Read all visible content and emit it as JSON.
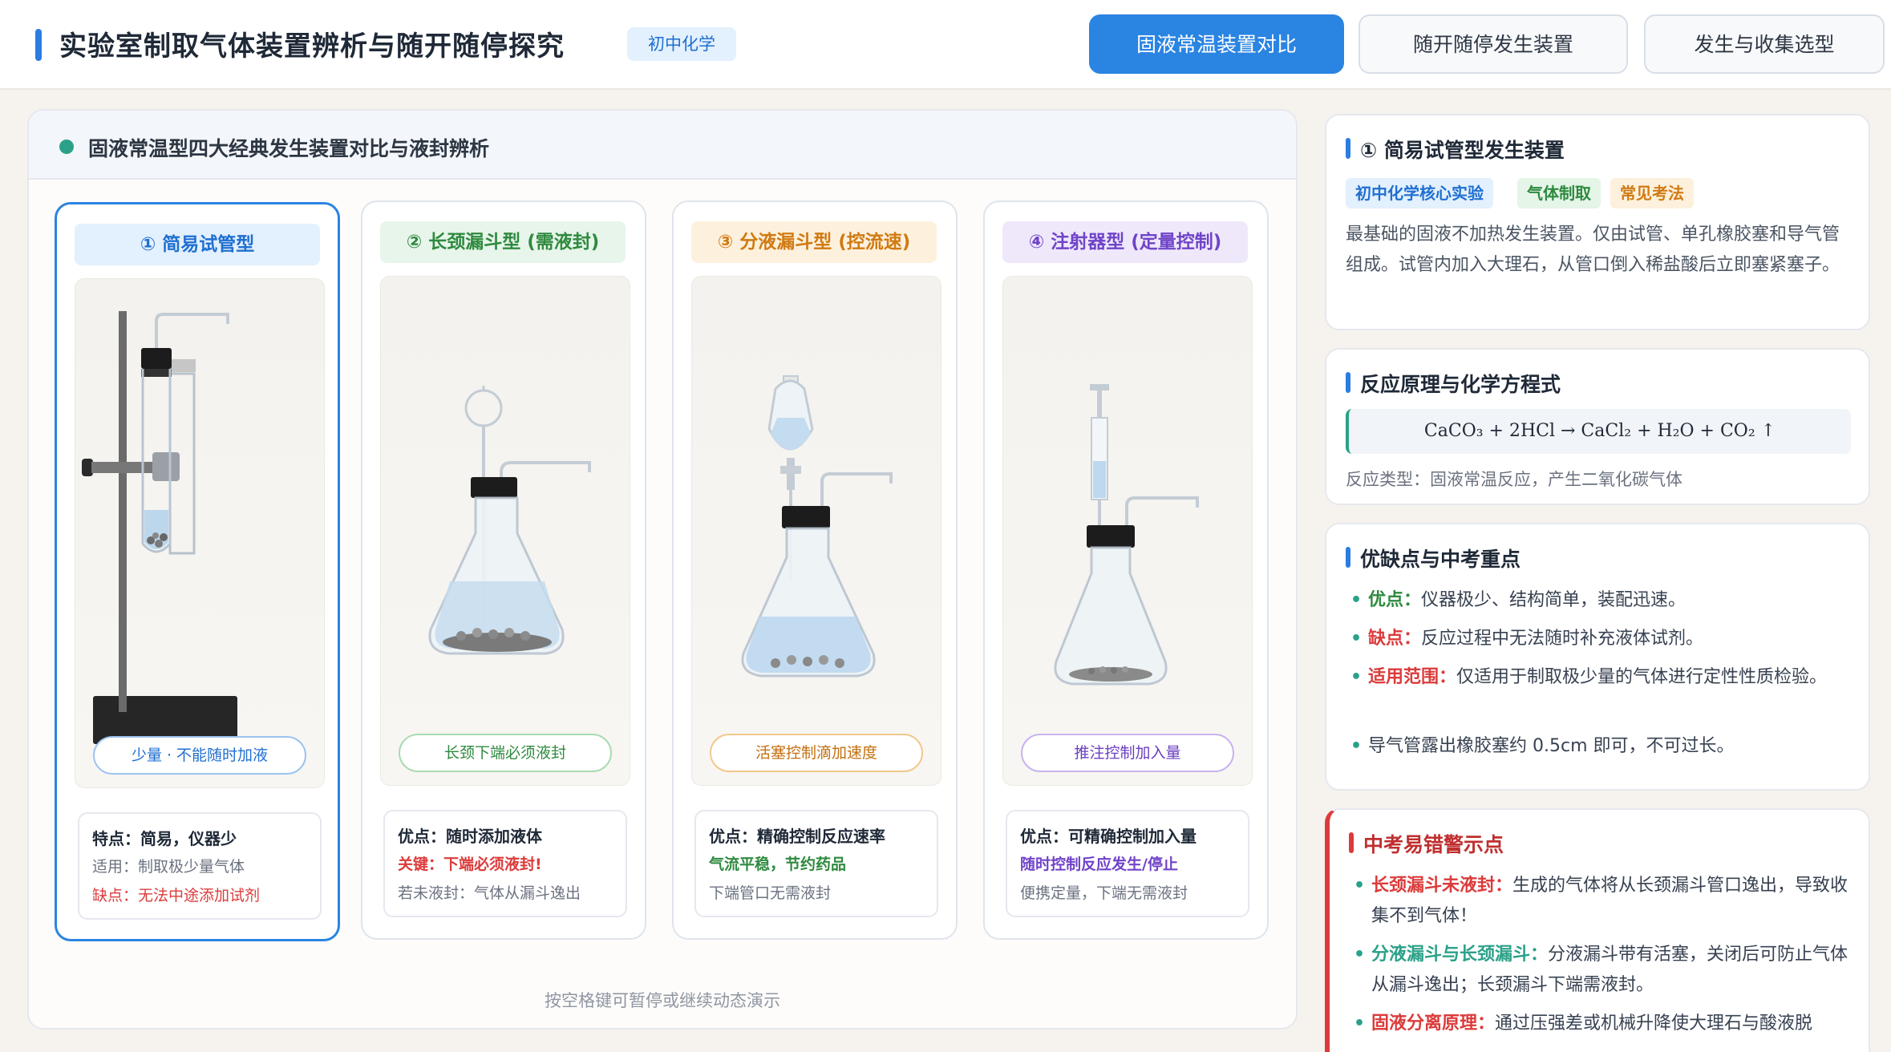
{
  "header": {
    "title": "实验室制取气体装置辨析与随开随停探究",
    "badge": "初中化学",
    "tabs": [
      {
        "label": "固液常温装置对比",
        "active": true
      },
      {
        "label": "随开随停发生装置",
        "active": false
      },
      {
        "label": "发生与收集选型",
        "active": false
      }
    ]
  },
  "left": {
    "title": "固液常温型四大经典发生装置对比与液封辨析",
    "hint": "按空格键可暂停或继续动态演示",
    "cards": [
      {
        "title": "① 简易试管型",
        "pill": "少量 · 不能随时加液",
        "line1": "特点：简易，仪器少",
        "line2": "适用：制取极少量气体",
        "line3": "缺点：无法中途添加试剂"
      },
      {
        "title": "② 长颈漏斗型 (需液封)",
        "pill": "长颈下端必须液封",
        "line1": "优点：随时添加液体",
        "line2": "关键：下端必须液封!",
        "line3": "若未液封：气体从漏斗逸出"
      },
      {
        "title": "③ 分液漏斗型 (控流速)",
        "pill": "活塞控制滴加速度",
        "line1": "优点：精确控制反应速率",
        "line2": "气流平稳，节约药品",
        "line3": "下端管口无需液封"
      },
      {
        "title": "④ 注射器型 (定量控制)",
        "pill": "推注控制加入量",
        "line1": "优点：可精确控制加入量",
        "line2": "随时控制反应发生/停止",
        "line3": "便携定量，下端无需液封"
      }
    ]
  },
  "right": {
    "device": {
      "title": "① 简易试管型发生装置",
      "tags": [
        "初中化学核心实验",
        "气体制取",
        "常见考法"
      ],
      "desc": "最基础的固液不加热发生装置。仅由试管、单孔橡胶塞和导气管组成。试管内加入大理石，从管口倒入稀盐酸后立即塞紧塞子。"
    },
    "reaction": {
      "title": "反应原理与化学方程式",
      "equation": "CaCO₃ + 2HCl → CaCl₂ + H₂O + CO₂ ↑",
      "type": "反应类型：固液常温反应，产生二氧化碳气体"
    },
    "pros": {
      "title": "优缺点与中考重点",
      "items": [
        {
          "label": "优点：",
          "text": "仪器极少、结构简单，装配迅速。"
        },
        {
          "label": "缺点：",
          "text": "反应过程中无法随时补充液体试剂。"
        },
        {
          "label": "适用范围：",
          "text": "仅适用于制取极少量的气体进行定性性质检验。"
        },
        {
          "label": "",
          "text": "导气管露出橡胶塞约 0.5cm 即可，不可过长。"
        }
      ]
    },
    "warn": {
      "title": "中考易错警示点",
      "items": [
        {
          "label": "长颈漏斗未液封：",
          "text": "生成的气体将从长颈漏斗管口逸出，导致收集不到气体！"
        },
        {
          "label": "分液漏斗与长颈漏斗：",
          "text": "分液漏斗带有活塞，关闭后可防止气体从漏斗逸出；长颈漏斗下端需液封。"
        },
        {
          "label": "固液分离原理：",
          "text": "通过压强差或机械升降使大理石与酸液脱"
        }
      ]
    }
  },
  "colors": {
    "accent": "#2a84e2",
    "green": "#2aa188",
    "orange": "#e08a1e",
    "purple": "#7b4fd6",
    "red": "#dc3b3b"
  }
}
